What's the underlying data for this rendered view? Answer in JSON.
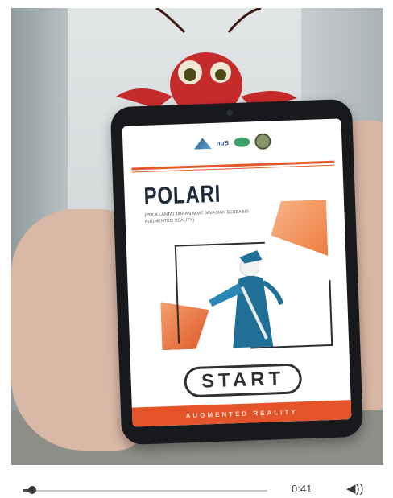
{
  "app": {
    "title": "POLARI",
    "subtitle": "(POLA LANTAI TARIAN ADAT JAVA DAN BERBASIS AUGMENTED REALITY)",
    "start_label": "START",
    "footer_label": "AUGMENTED REALITY",
    "logo_text": "nuB"
  },
  "player": {
    "time": "0:41",
    "progress": 0.04
  },
  "icons": {
    "volume": "volume-icon"
  },
  "colors": {
    "accent": "#e4542a",
    "phone": "#17191c"
  }
}
